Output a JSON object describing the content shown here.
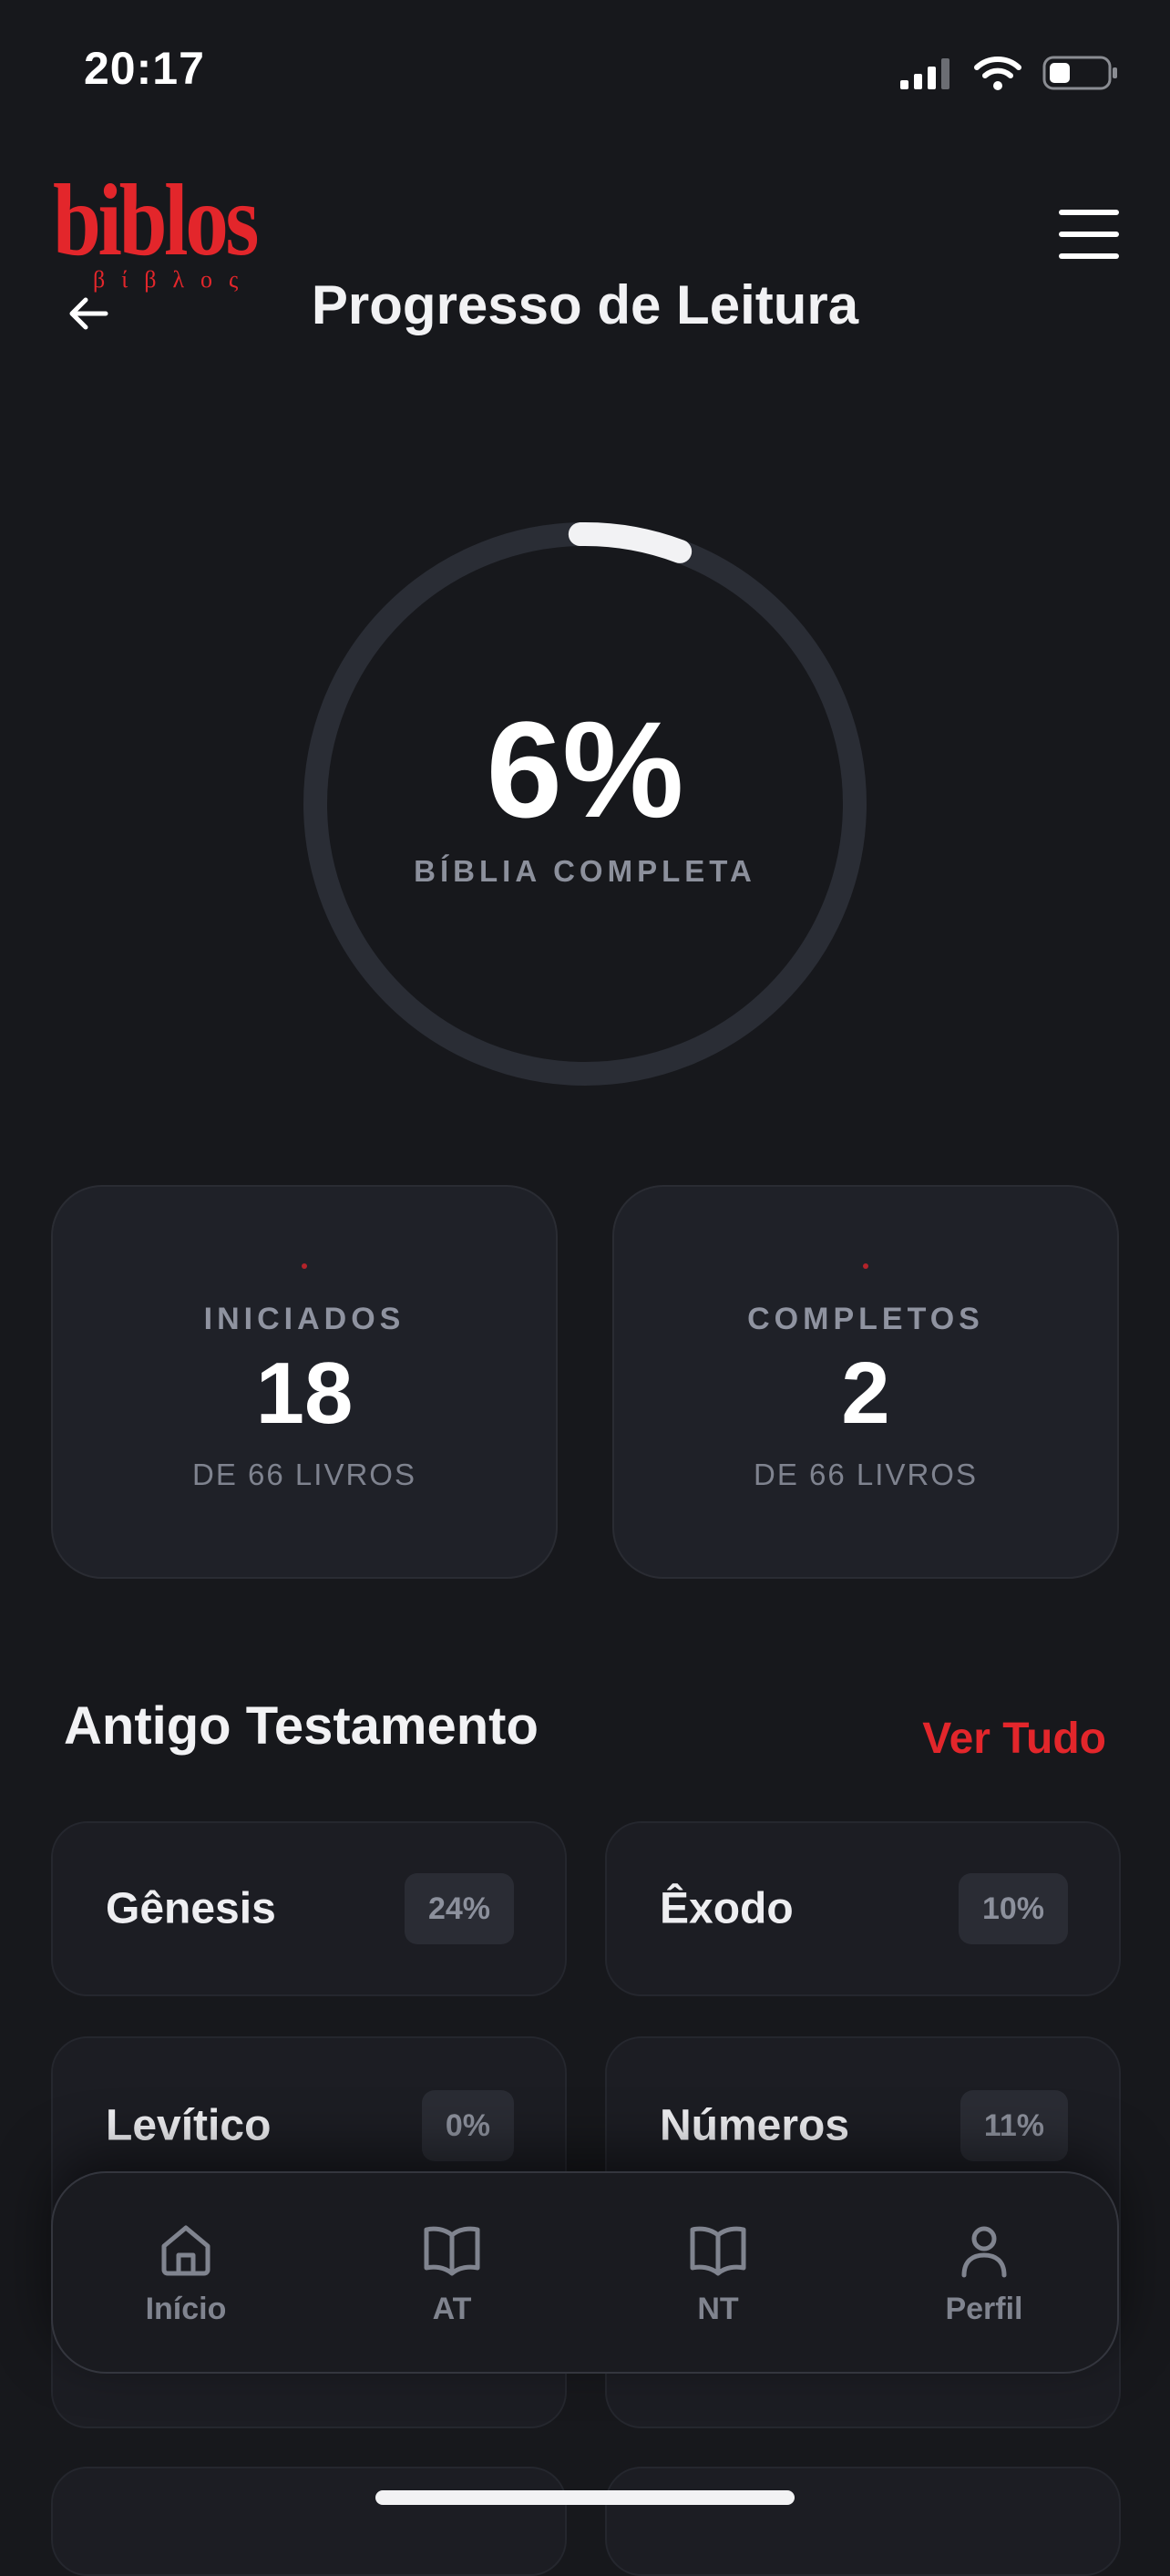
{
  "status_bar": {
    "time": "20:17"
  },
  "header": {
    "logo_text": "biblos",
    "logo_greek": "βίβλος",
    "title": "Progresso de Leitura"
  },
  "progress": {
    "percent_label": "6%",
    "percent_value": 6,
    "label": "BÍBLIA COMPLETA"
  },
  "stats": [
    {
      "label": "INICIADOS",
      "value": "18",
      "sub": "DE 66 LIVROS"
    },
    {
      "label": "COMPLETOS",
      "value": "2",
      "sub": "DE 66 LIVROS"
    }
  ],
  "section": {
    "title": "Antigo Testamento",
    "see_all": "Ver Tudo"
  },
  "books": [
    {
      "name": "Gênesis",
      "pct": "24%"
    },
    {
      "name": "Êxodo",
      "pct": "10%"
    },
    {
      "name": "Levítico",
      "pct": "0%"
    },
    {
      "name": "Números",
      "pct": "11%"
    }
  ],
  "nav": [
    {
      "label": "Início",
      "icon": "home-icon"
    },
    {
      "label": "AT",
      "icon": "book-open-icon"
    },
    {
      "label": "NT",
      "icon": "book-open-icon"
    },
    {
      "label": "Perfil",
      "icon": "user-icon"
    }
  ],
  "colors": {
    "background": "#17181c",
    "accent": "#e3262b",
    "card": "#1f2128",
    "ring_track": "#2a2d35",
    "ring_fill": "#f2f2f4"
  }
}
